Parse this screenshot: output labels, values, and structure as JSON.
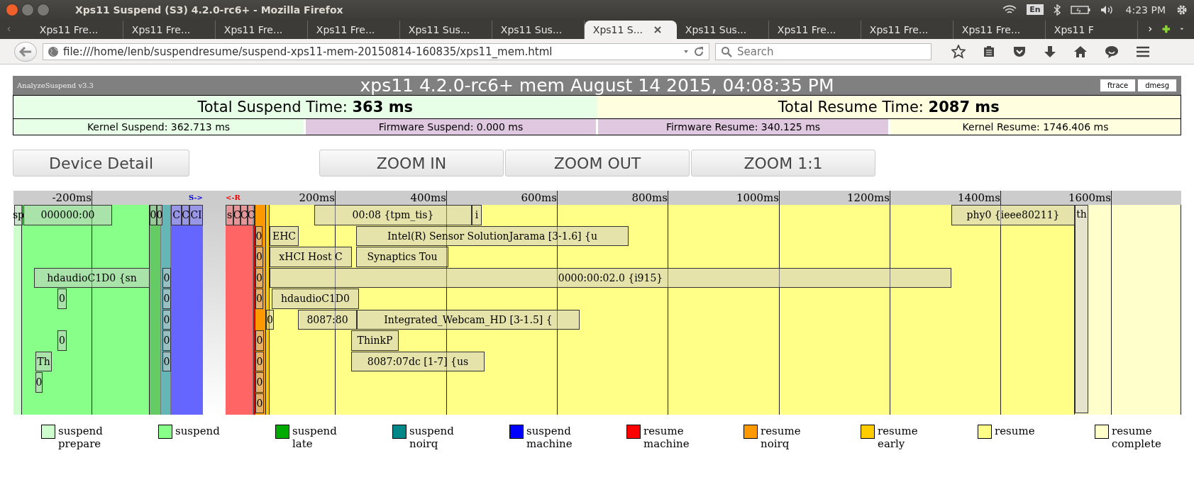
{
  "window": {
    "title": "Xps11 Suspend (S3) 4.2.0-rc6+ - Mozilla Firefox"
  },
  "tray": {
    "language": "En",
    "clock": "4:23 PM"
  },
  "tabs": [
    {
      "label": "Xps11 Fre...",
      "selected": false
    },
    {
      "label": "Xps11 Fre...",
      "selected": false
    },
    {
      "label": "Xps11 Fre...",
      "selected": false
    },
    {
      "label": "Xps11 Fre...",
      "selected": false
    },
    {
      "label": "Xps11 Sus...",
      "selected": false
    },
    {
      "label": "Xps11 Sus...",
      "selected": false
    },
    {
      "label": "Xps11 S...",
      "selected": true
    },
    {
      "label": "Xps11 Sus...",
      "selected": false
    },
    {
      "label": "Xps11 Fre...",
      "selected": false
    },
    {
      "label": "Xps11 Fre...",
      "selected": false
    },
    {
      "label": "Xps11 Fre...",
      "selected": false
    },
    {
      "label": "Xps11 F",
      "selected": false
    }
  ],
  "address_bar": {
    "url": "file:///home/lenb/suspendresume/suspend-xps11-mem-20150814-160835/xps11_mem.html"
  },
  "search": {
    "placeholder": "Search"
  },
  "report": {
    "version": "AnalyzeSuspend v3.3",
    "title": "xps11 4.2.0-rc6+ mem August 14 2015, 04:08:35 PM",
    "log_buttons": [
      "ftrace",
      "dmesg"
    ],
    "totals": [
      {
        "kind": "suspend",
        "text": "Total Suspend Time: **363 ms**"
      },
      {
        "kind": "resume",
        "text": "Total Resume Time: **2087 ms**"
      }
    ],
    "breakdown": [
      {
        "kind": "suspend",
        "text": "Kernel Suspend: 362.713 ms"
      },
      {
        "kind": "firmware",
        "text": "Firmware Suspend: 0.000 ms"
      },
      {
        "kind": "firmware",
        "text": "Firmware Resume: 340.125 ms"
      },
      {
        "kind": "resume",
        "text": "Kernel Resume: 1746.406 ms"
      }
    ],
    "buttons": [
      "Device Detail",
      "ZOOM IN",
      "ZOOM OUT",
      "ZOOM 1:1"
    ],
    "timeline": {
      "ticks": [
        "-200ms",
        "200ms",
        "400ms",
        "600ms",
        "800ms",
        "1000ms",
        "1200ms",
        "1400ms",
        "1600ms"
      ],
      "suspend_marker": "S->",
      "resume_marker": "<-R",
      "devices": [
        "sp",
        "000000:00",
        "hdaudioC1D0 {sn",
        "0",
        "0",
        "Th",
        "0",
        "0",
        "0",
        "C",
        "C",
        "CI",
        "0",
        "0",
        "0",
        "0",
        "0",
        "s",
        "C",
        "C",
        "C",
        "00:08 {tpm_tis}",
        "i",
        "0",
        "EHC",
        "Intel(R) Sensor SolutionJarama [3-1.6] {u",
        "0",
        "xHCI Host C",
        "Synaptics Tou",
        "0",
        "0000:00:02.0 {i915}",
        "0",
        "hdaudioC1D0",
        "0",
        "8087:80",
        "Integrated_Webcam_HD [3-1.5] {",
        "0",
        "ThinkP",
        "0",
        "8087:07dc [1-7] {us",
        "0",
        "0",
        "phy0 {ieee80211}",
        "th"
      ]
    }
  },
  "legend": [
    {
      "label": "suspend prepare",
      "color": "#ccffcc"
    },
    {
      "label": "suspend",
      "color": "#88ff88"
    },
    {
      "label": "suspend late",
      "color": "#00aa00"
    },
    {
      "label": "suspend noirq",
      "color": "#008888"
    },
    {
      "label": "suspend machine",
      "color": "#0000ff"
    },
    {
      "label": "resume machine",
      "color": "#ff0000"
    },
    {
      "label": "resume noirq",
      "color": "#ff9900"
    },
    {
      "label": "resume early",
      "color": "#ffcc00"
    },
    {
      "label": "resume",
      "color": "#ffff88"
    },
    {
      "label": "resume complete",
      "color": "#ffffcc"
    }
  ]
}
